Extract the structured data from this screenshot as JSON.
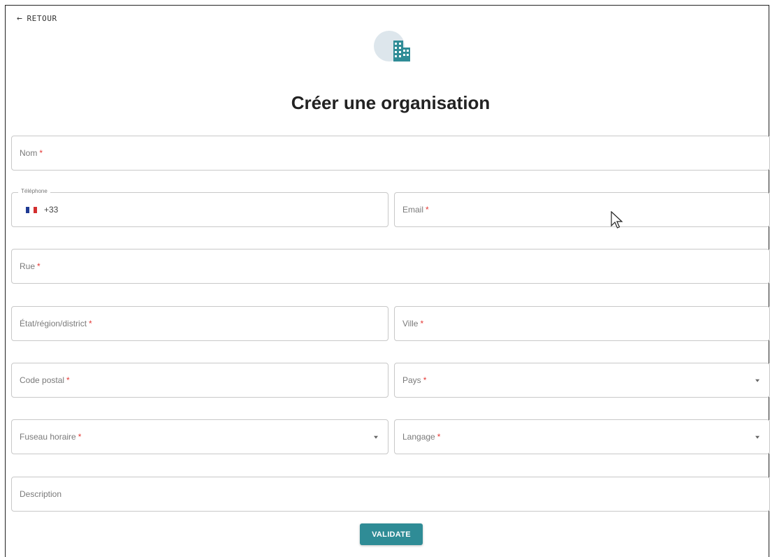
{
  "nav": {
    "back_label": "RETOUR",
    "back_icon": "arrow-left-icon"
  },
  "header": {
    "title": "Créer une organisation",
    "logo_icon": "building-icon"
  },
  "form": {
    "nom": {
      "placeholder": "Nom",
      "required": "*"
    },
    "telephone": {
      "legend": "Téléphone",
      "country_flag": "flag-fr-icon",
      "dial_code": "+33"
    },
    "email": {
      "placeholder": "Email",
      "required": "*"
    },
    "rue": {
      "placeholder": "Rue",
      "required": "*"
    },
    "etat": {
      "placeholder": "État/région/district",
      "required": "*"
    },
    "ville": {
      "placeholder": "Ville",
      "required": "*"
    },
    "code_postal": {
      "placeholder": "Code postal",
      "required": "*"
    },
    "pays": {
      "placeholder": "Pays",
      "required": "*"
    },
    "fuseau": {
      "placeholder": "Fuseau horaire",
      "required": "*"
    },
    "langage": {
      "placeholder": "Langage",
      "required": "*"
    },
    "description": {
      "placeholder": "Description"
    },
    "submit_label": "VALIDATE"
  },
  "colors": {
    "accent": "#2f8c96",
    "required": "#e53935",
    "logo_circle": "#dde6ec"
  }
}
